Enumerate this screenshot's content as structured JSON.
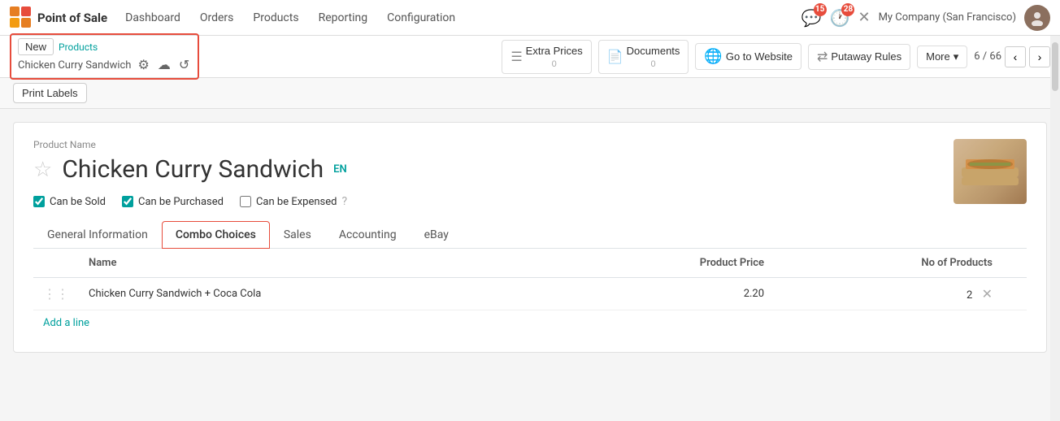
{
  "nav": {
    "brand": "Point of Sale",
    "items": [
      "Dashboard",
      "Orders",
      "Products",
      "Reporting",
      "Configuration"
    ],
    "notifications_count": "15",
    "activity_count": "28",
    "company": "My Company (San Francisco)",
    "avatar_text": "👤"
  },
  "breadcrumb": {
    "new_label": "New",
    "products_link": "Products",
    "current_page": "Chicken Curry Sandwich"
  },
  "toolbar": {
    "extra_prices_label": "Extra Prices",
    "extra_prices_count": "0",
    "documents_label": "Documents",
    "documents_count": "0",
    "go_website_label": "Go to Website",
    "putaway_rules_label": "Putaway Rules",
    "more_label": "More",
    "pagination": "6 / 66"
  },
  "print_labels": {
    "label": "Print Labels"
  },
  "product": {
    "name_label": "Product Name",
    "title": "Chicken Curry Sandwich",
    "lang": "EN",
    "can_be_sold": true,
    "can_be_sold_label": "Can be Sold",
    "can_be_purchased": true,
    "can_be_purchased_label": "Can be Purchased",
    "can_be_expensed": false,
    "can_be_expensed_label": "Can be Expensed"
  },
  "tabs": [
    {
      "id": "general",
      "label": "General Information"
    },
    {
      "id": "combo",
      "label": "Combo Choices",
      "active": true
    },
    {
      "id": "sales",
      "label": "Sales"
    },
    {
      "id": "accounting",
      "label": "Accounting"
    },
    {
      "id": "ebay",
      "label": "eBay"
    }
  ],
  "table": {
    "col_name": "Name",
    "col_price": "Product Price",
    "col_products": "No of Products",
    "rows": [
      {
        "name": "Chicken Curry Sandwich + Coca Cola",
        "price": "2.20",
        "products": "2"
      }
    ],
    "add_line": "Add a line"
  }
}
